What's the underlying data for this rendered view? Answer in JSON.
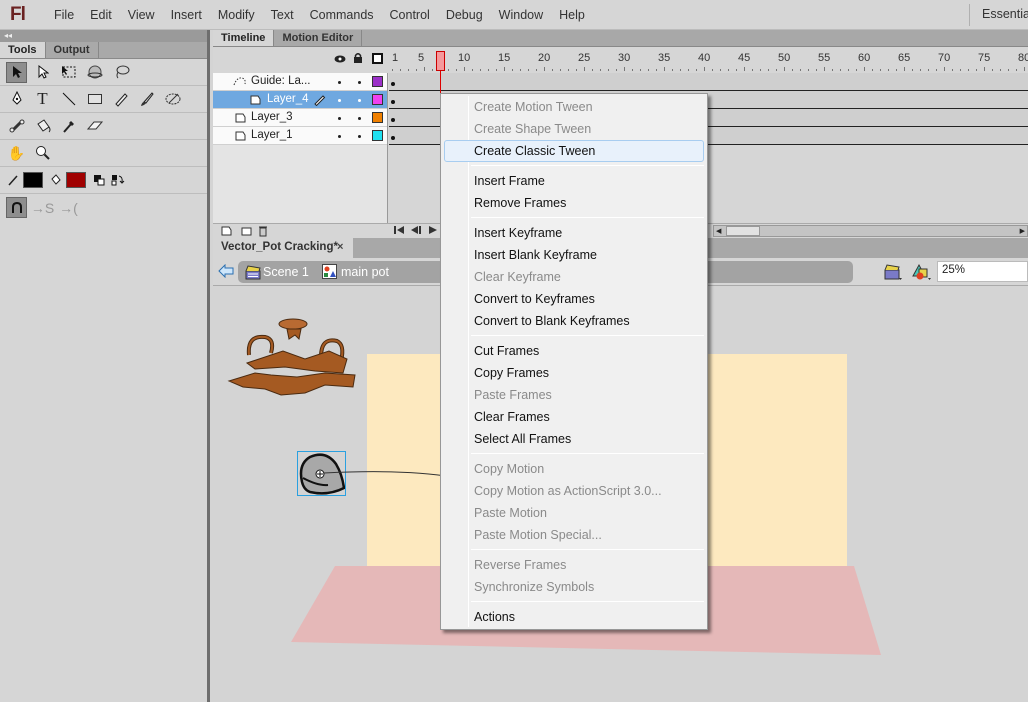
{
  "app": {
    "logo": "Fl",
    "workspace": "Essentials"
  },
  "menubar": {
    "items": [
      "File",
      "Edit",
      "View",
      "Insert",
      "Modify",
      "Text",
      "Commands",
      "Control",
      "Debug",
      "Window",
      "Help"
    ]
  },
  "tools_panel": {
    "collapse_glyph": "◂◂",
    "tabs": [
      "Tools",
      "Output"
    ],
    "active_tab": "Tools",
    "stroke_color": "#000000",
    "fill_color": "#a00000",
    "tools": [
      [
        "selection-tool",
        "subselection-tool",
        "free-transform-tool",
        "3d-rotation-tool",
        "lasso-tool"
      ],
      [
        "pen-tool",
        "text-tool",
        "line-tool",
        "rectangle-tool",
        "pencil-tool",
        "brush-tool",
        "deco-tool"
      ],
      [
        "bone-tool",
        "paint-bucket-tool",
        "eyedropper-tool",
        "eraser-tool"
      ],
      [
        "hand-tool",
        "zoom-tool"
      ]
    ],
    "selected_tool": "selection-tool"
  },
  "timeline": {
    "tabs": [
      "Timeline",
      "Motion Editor"
    ],
    "active_tab": "Timeline",
    "ruler_labels": [
      "1",
      "5",
      "10",
      "15",
      "20",
      "25",
      "30",
      "35",
      "40",
      "45",
      "50",
      "55",
      "60",
      "65",
      "70",
      "75",
      "80"
    ],
    "current_frame": 7,
    "layers": [
      {
        "name": "Guide: La...",
        "type": "guide",
        "color": "#9b30c8",
        "selected": false
      },
      {
        "name": "Layer_4",
        "type": "guided",
        "color": "#f040f0",
        "selected": true,
        "editing": true
      },
      {
        "name": "Layer_3",
        "type": "normal",
        "color": "#f08000",
        "selected": false
      },
      {
        "name": "Layer_1",
        "type": "normal",
        "color": "#20e0f0",
        "selected": false
      }
    ]
  },
  "document": {
    "tab_title": "Vector_Pot Cracking*",
    "close_glyph": "×",
    "breadcrumbs": [
      "Scene 1",
      "main pot"
    ],
    "zoom": "25%"
  },
  "context_menu": {
    "items": [
      {
        "label": "Create Motion Tween",
        "enabled": false
      },
      {
        "label": "Create Shape Tween",
        "enabled": false
      },
      {
        "label": "Create Classic Tween",
        "enabled": true,
        "highlighted": true
      },
      {
        "separator": true
      },
      {
        "label": "Insert Frame",
        "enabled": true
      },
      {
        "label": "Remove Frames",
        "enabled": true
      },
      {
        "separator": true
      },
      {
        "label": "Insert Keyframe",
        "enabled": true
      },
      {
        "label": "Insert Blank Keyframe",
        "enabled": true
      },
      {
        "label": "Clear Keyframe",
        "enabled": false
      },
      {
        "label": "Convert to Keyframes",
        "enabled": true
      },
      {
        "label": "Convert to Blank Keyframes",
        "enabled": true
      },
      {
        "separator": true
      },
      {
        "label": "Cut Frames",
        "enabled": true
      },
      {
        "label": "Copy Frames",
        "enabled": true
      },
      {
        "label": "Paste Frames",
        "enabled": false
      },
      {
        "label": "Clear Frames",
        "enabled": true
      },
      {
        "label": "Select All Frames",
        "enabled": true
      },
      {
        "separator": true
      },
      {
        "label": "Copy Motion",
        "enabled": false
      },
      {
        "label": "Copy Motion as ActionScript 3.0...",
        "enabled": false
      },
      {
        "label": "Paste Motion",
        "enabled": false
      },
      {
        "label": "Paste Motion Special...",
        "enabled": false
      },
      {
        "separator": true
      },
      {
        "label": "Reverse Frames",
        "enabled": false
      },
      {
        "label": "Synchronize Symbols",
        "enabled": false
      },
      {
        "separator": true
      },
      {
        "label": "Actions",
        "enabled": true
      }
    ]
  },
  "stage": {
    "background_color": "#fde9bf",
    "floor_color": "#e5b8b8"
  }
}
